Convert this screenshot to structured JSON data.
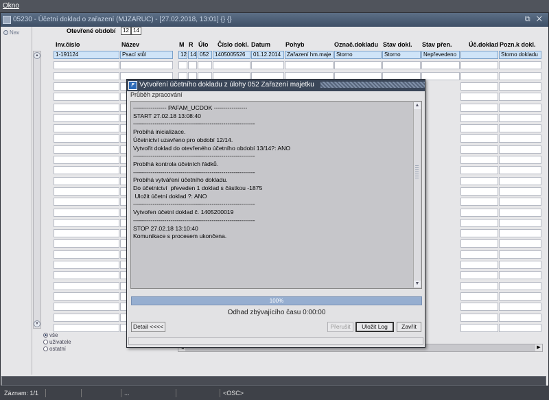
{
  "menubar": {
    "okno": "Okno"
  },
  "window": {
    "title": "05230 - Účetní doklad o zařazení (MJZARUC) - [27.02.2018, 13:01] {} {}",
    "controls": "⧉ ✕"
  },
  "left": {
    "nav": "Nav"
  },
  "period": {
    "label": "Otevřené období",
    "v1": "12",
    "v2": "14"
  },
  "columns": {
    "inv": "Inv.číslo",
    "nazev": "Název",
    "m": "M",
    "r": "R",
    "ulo": "Úlo",
    "cislo": "Číslo dokl.",
    "datum": "Datum",
    "pohyb": "Pohyb",
    "oznac": "Označ.dokladu",
    "stav": "Stav dokl.",
    "stavpren": "Stav přen.",
    "ucdoklad": "Úč.doklad",
    "pozn": "Pozn.k dokl."
  },
  "row1": {
    "inv": "1-191124",
    "nazev": "Psací stůl",
    "m": "12",
    "r": "14",
    "ulo": "052",
    "cislo": "1405005526",
    "datum": "01.12.2014",
    "pohyb": "Zařazení hm.maje",
    "oznac": "Storno",
    "stav": "Storno",
    "stavpren": "Nepřevedeno",
    "ucdoklad": "",
    "pozn": "Storno dokladu"
  },
  "filter": {
    "vse": "vše",
    "uzivatele": "uživatele",
    "ostatni": "ostatní"
  },
  "status": {
    "zaznam": "Záznam: 1/1",
    "dots": "...",
    "osc": "<OSC>"
  },
  "dialog": {
    "title": "Vytvoření účetního dokladu z úlohy 052 Zařazení majetku",
    "subtitle": "Průběh zpracování",
    "log": "----------------- PAFAM_UCDOK -----------------\nSTART 27.02.18 13:08:40\n--------------------------------------------------------------\nProbíhá inicializace.\nÚčetnictví uzavřeno pro období 12/14.\nVytvořit doklad do otevřeného účetního období 13/14?: ANO\n--------------------------------------------------------------\nProbíhá kontrola účetních řádků.\n--------------------------------------------------------------\nProbíhá vytváření účetního dokladu.\nDo účetnictví  převeden 1 doklad s částkou -1875\n Uložit účetní doklad ?: ANO\n--------------------------------------------------------------\nVytvořen účetní doklad č. 1405200019\n--------------------------------------------------------------\nSTOP 27.02.18 13:10:40\nKomunikace s procesem ukončena.",
    "progress_label": "100%",
    "progress": 1.0,
    "eta": "Odhad zbývajícího času 0:00:00",
    "btn_detail": "Detail <<<<",
    "btn_prerusit": "Přerušit",
    "btn_ulozit": "Uložit Log",
    "btn_zavrit": "Zavřít"
  }
}
